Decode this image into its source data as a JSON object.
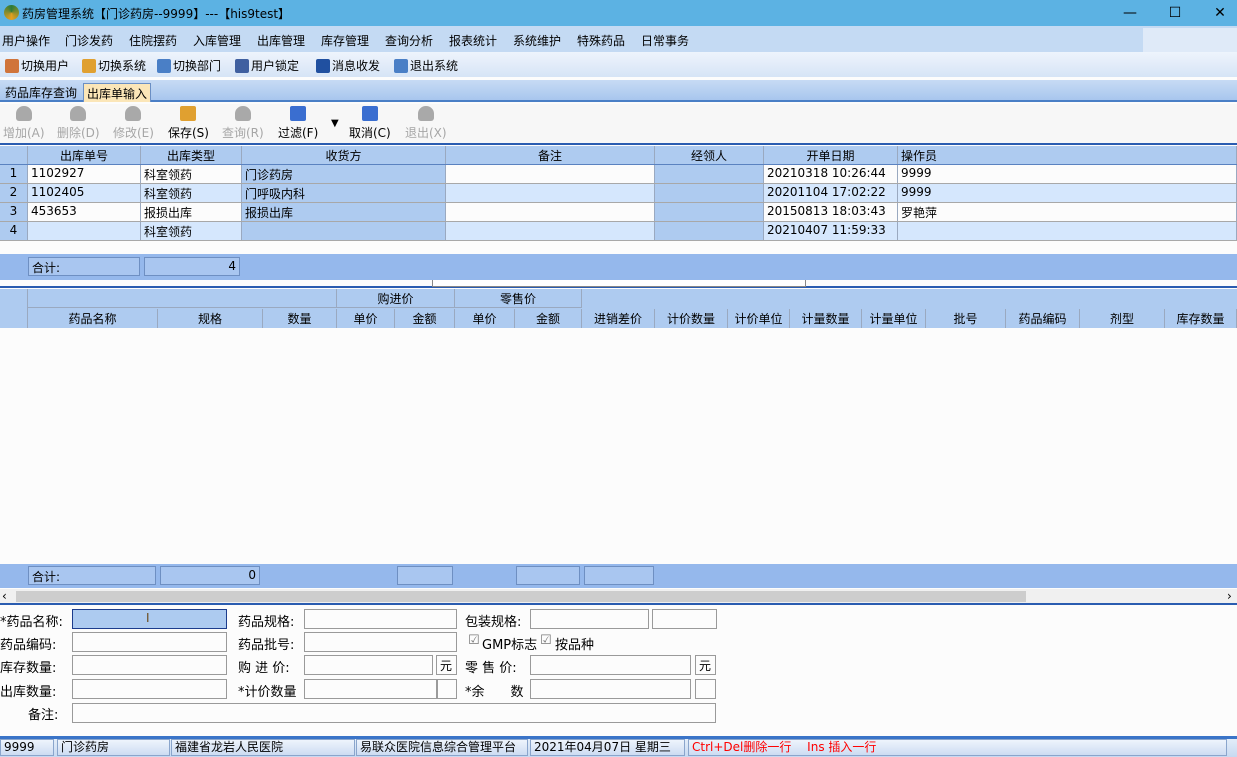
{
  "window": {
    "title": "药房管理系统【门诊药房--9999】---【his9test】",
    "controls": [
      "—",
      "☐",
      "✕"
    ]
  },
  "menu": [
    "用户操作",
    "门诊发药",
    "住院摆药",
    "入库管理",
    "出库管理",
    "库存管理",
    "查询分析",
    "报表统计",
    "系统维护",
    "特殊药品",
    "日常事务"
  ],
  "toolbar": [
    {
      "label": "切换用户",
      "icon": "switch-user-icon",
      "color": "#d0743a"
    },
    {
      "label": "切换系统",
      "icon": "switch-system-icon",
      "color": "#e0a030"
    },
    {
      "label": "切换部门",
      "icon": "switch-department-icon",
      "color": "#4a7fc6"
    },
    {
      "label": "用户锁定",
      "icon": "user-lock-icon",
      "color": "#4060a0"
    },
    {
      "label": "消息收发",
      "icon": "info-message-icon",
      "color": "#2050a0"
    },
    {
      "label": "退出系统",
      "icon": "exit-icon",
      "color": "#4a7fc6"
    }
  ],
  "tabs": [
    {
      "label": "药品库存查询"
    },
    {
      "label": "出库单输入",
      "active": true
    }
  ],
  "actions": [
    {
      "label": "增加(A)",
      "enabled": false
    },
    {
      "label": "删除(D)",
      "enabled": false
    },
    {
      "label": "修改(E)",
      "enabled": false
    },
    {
      "label": "保存(S)",
      "enabled": true
    },
    {
      "label": "查询(R)",
      "enabled": false
    },
    {
      "label": "过滤(F)",
      "enabled": true
    },
    {
      "label": "取消(C)",
      "enabled": true
    },
    {
      "label": "退出(X)",
      "enabled": false
    }
  ],
  "master": {
    "columns": [
      "",
      "出库单号",
      "出库类型",
      "收货方",
      "备注",
      "经领人",
      "开单日期",
      "操作员"
    ],
    "rows": [
      [
        "1",
        "1102927",
        "科室领药",
        "门诊药房",
        "",
        "",
        "20210318 10:26:44",
        "9999"
      ],
      [
        "2",
        "1102405",
        "科室领药",
        "门呼吸内科",
        "",
        "",
        "20201104 17:02:22",
        "9999"
      ],
      [
        "3",
        "453653",
        "报损出库",
        "报损出库",
        "",
        "",
        "20150813 18:03:43",
        "罗艳萍"
      ],
      [
        "4",
        "",
        "科室领药",
        "",
        "",
        "",
        "20210407 11:59:33",
        ""
      ]
    ],
    "total_label": "合计:",
    "total_count": "4"
  },
  "detail": {
    "group_headers": [
      "购进价",
      "零售价"
    ],
    "columns": [
      "药品名称",
      "规格",
      "数量",
      "单价",
      "金额",
      "单价",
      "金额",
      "进销差价",
      "计价数量",
      "计价单位",
      "计量数量",
      "计量单位",
      "批号",
      "药品编码",
      "剂型",
      "库存数量"
    ],
    "total_label": "合计:",
    "total_value": "0"
  },
  "form": {
    "drug_name": "*药品名称:",
    "drug_spec": "药品规格:",
    "pack_spec": "包装规格:",
    "drug_code": "药品编码:",
    "batch_no": "药品批号:",
    "gmp": "GMP标志",
    "by_variety": "按品种",
    "stock_qty": "库存数量:",
    "purchase_price": "购 进 价:",
    "yuan": "元",
    "retail_price": "零 售 价:",
    "out_qty": "出库数量:",
    "price_qty": "*计价数量",
    "remain": "*余　　数",
    "remark": "备注:",
    "gmp_checked": true,
    "by_variety_checked": true
  },
  "status": {
    "user": "9999",
    "dept": "门诊药房",
    "hospital": "福建省龙岩人民医院",
    "platform": "易联众医院信息综合管理平台",
    "date": "2021年04月07日 星期三",
    "hint": "Ctrl+Del删除一行　 Ins 插入一行",
    "hint_color": "#ff0000"
  }
}
